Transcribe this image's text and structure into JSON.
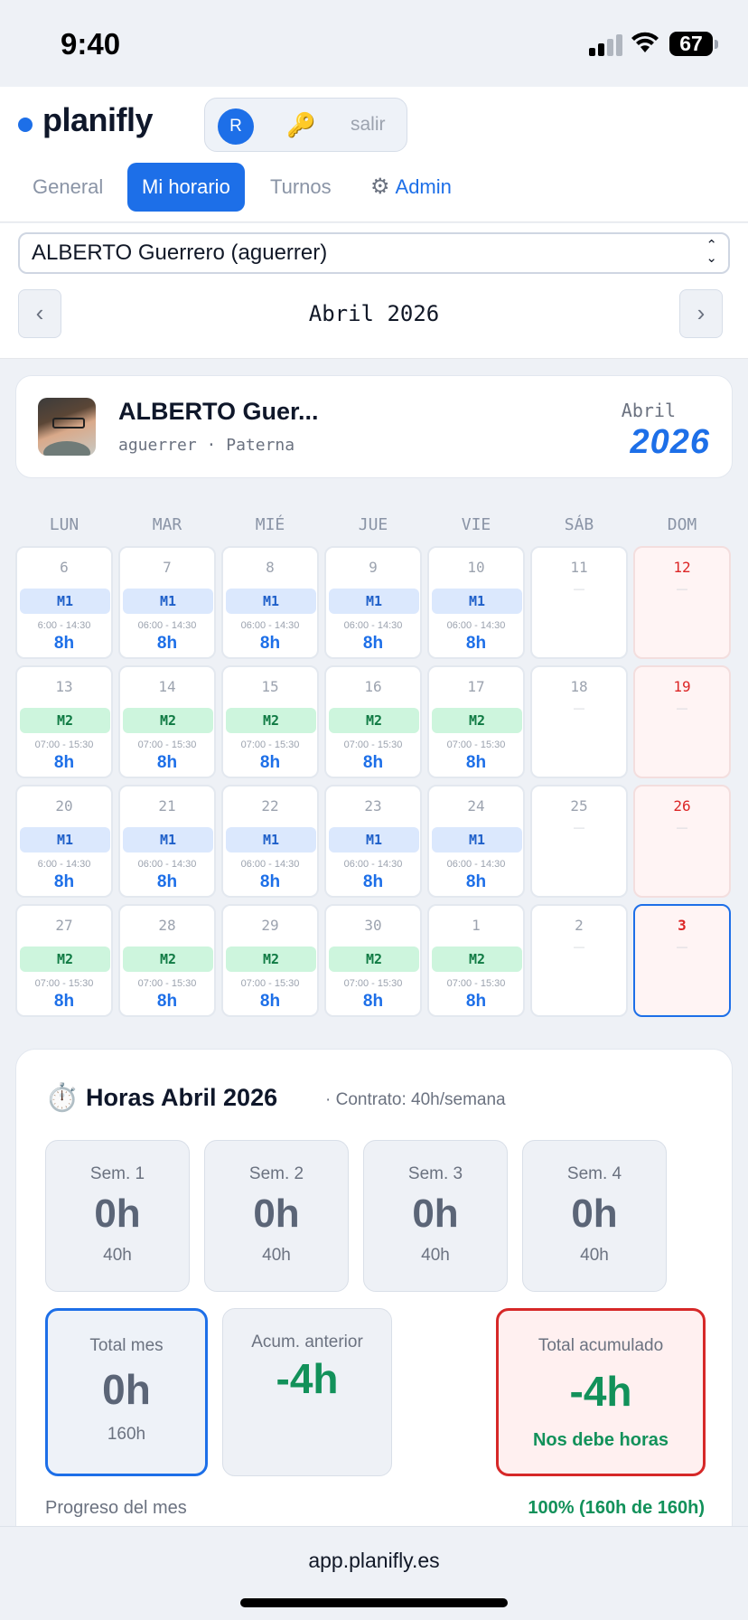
{
  "status": {
    "time": "9:40",
    "battery": "67"
  },
  "header": {
    "logo": "planifly",
    "user_initial": "R",
    "logout_label": "salir",
    "tabs": [
      {
        "label": "General"
      },
      {
        "label": "Mi horario"
      },
      {
        "label": "Turnos"
      },
      {
        "label": "Admin"
      }
    ]
  },
  "controls": {
    "employee": "ALBERTO Guerrero (aguerrer)",
    "prev": "‹",
    "next": "›",
    "month": "Abril 2026"
  },
  "profile": {
    "name": "ALBERTO Guer...",
    "username": "aguerrer",
    "separator": "·",
    "location": "Paterna",
    "month": "Abril",
    "year": "2026"
  },
  "calendar": {
    "weekdays": [
      "LUN",
      "MAR",
      "MIÉ",
      "JUE",
      "VIE",
      "SÁB",
      "DOM"
    ],
    "dash": "—",
    "weeks": [
      [
        {
          "day": "6",
          "shift": "M1",
          "time": "6:00 - 14:30",
          "hours": "8h"
        },
        {
          "day": "7",
          "shift": "M1",
          "time": "06:00 - 14:30",
          "hours": "8h"
        },
        {
          "day": "8",
          "shift": "M1",
          "time": "06:00 - 14:30",
          "hours": "8h"
        },
        {
          "day": "9",
          "shift": "M1",
          "time": "06:00 - 14:30",
          "hours": "8h"
        },
        {
          "day": "10",
          "shift": "M1",
          "time": "06:00 - 14:30",
          "hours": "8h"
        },
        {
          "day": "11"
        },
        {
          "day": "12"
        }
      ],
      [
        {
          "day": "13",
          "shift": "M2",
          "time": "07:00 - 15:30",
          "hours": "8h"
        },
        {
          "day": "14",
          "shift": "M2",
          "time": "07:00 - 15:30",
          "hours": "8h"
        },
        {
          "day": "15",
          "shift": "M2",
          "time": "07:00 - 15:30",
          "hours": "8h"
        },
        {
          "day": "16",
          "shift": "M2",
          "time": "07:00 - 15:30",
          "hours": "8h"
        },
        {
          "day": "17",
          "shift": "M2",
          "time": "07:00 - 15:30",
          "hours": "8h"
        },
        {
          "day": "18"
        },
        {
          "day": "19"
        }
      ],
      [
        {
          "day": "20",
          "shift": "M1",
          "time": "6:00 - 14:30",
          "hours": "8h"
        },
        {
          "day": "21",
          "shift": "M1",
          "time": "06:00 - 14:30",
          "hours": "8h"
        },
        {
          "day": "22",
          "shift": "M1",
          "time": "06:00 - 14:30",
          "hours": "8h"
        },
        {
          "day": "23",
          "shift": "M1",
          "time": "06:00 - 14:30",
          "hours": "8h"
        },
        {
          "day": "24",
          "shift": "M1",
          "time": "06:00 - 14:30",
          "hours": "8h"
        },
        {
          "day": "25"
        },
        {
          "day": "26"
        }
      ],
      [
        {
          "day": "27",
          "shift": "M2",
          "time": "07:00 - 15:30",
          "hours": "8h"
        },
        {
          "day": "28",
          "shift": "M2",
          "time": "07:00 - 15:30",
          "hours": "8h"
        },
        {
          "day": "29",
          "shift": "M2",
          "time": "07:00 - 15:30",
          "hours": "8h"
        },
        {
          "day": "30",
          "shift": "M2",
          "time": "07:00 - 15:30",
          "hours": "8h"
        },
        {
          "day": "1",
          "shift": "M2",
          "time": "07:00 - 15:30",
          "hours": "8h"
        },
        {
          "day": "2"
        },
        {
          "day": "3",
          "today": true
        }
      ]
    ]
  },
  "hours": {
    "title": "Horas Abril 2026",
    "contract": "· Contrato: 40h/semana",
    "weeks": [
      {
        "label": "Sem. 1",
        "value": "0h",
        "target": "40h"
      },
      {
        "label": "Sem. 2",
        "value": "0h",
        "target": "40h"
      },
      {
        "label": "Sem. 3",
        "value": "0h",
        "target": "40h"
      },
      {
        "label": "Sem. 4",
        "value": "0h",
        "target": "40h"
      }
    ],
    "total_month": {
      "label": "Total mes",
      "value": "0h",
      "target": "160h"
    },
    "previous": {
      "label": "Acum. anterior",
      "value": "-4h"
    },
    "accumulated": {
      "label": "Total acumulado",
      "value": "-4h",
      "note": "Nos debe horas"
    },
    "progress_label": "Progreso del mes",
    "progress_value": "100% (160h de 160h)"
  },
  "browser": {
    "url": "app.planifly.es"
  },
  "colors": {
    "accent": "#1d6fe8",
    "m1_bg": "#dbe8fd",
    "m2_bg": "#cdf5dd",
    "positive": "#12915a",
    "alert": "#d62828"
  }
}
